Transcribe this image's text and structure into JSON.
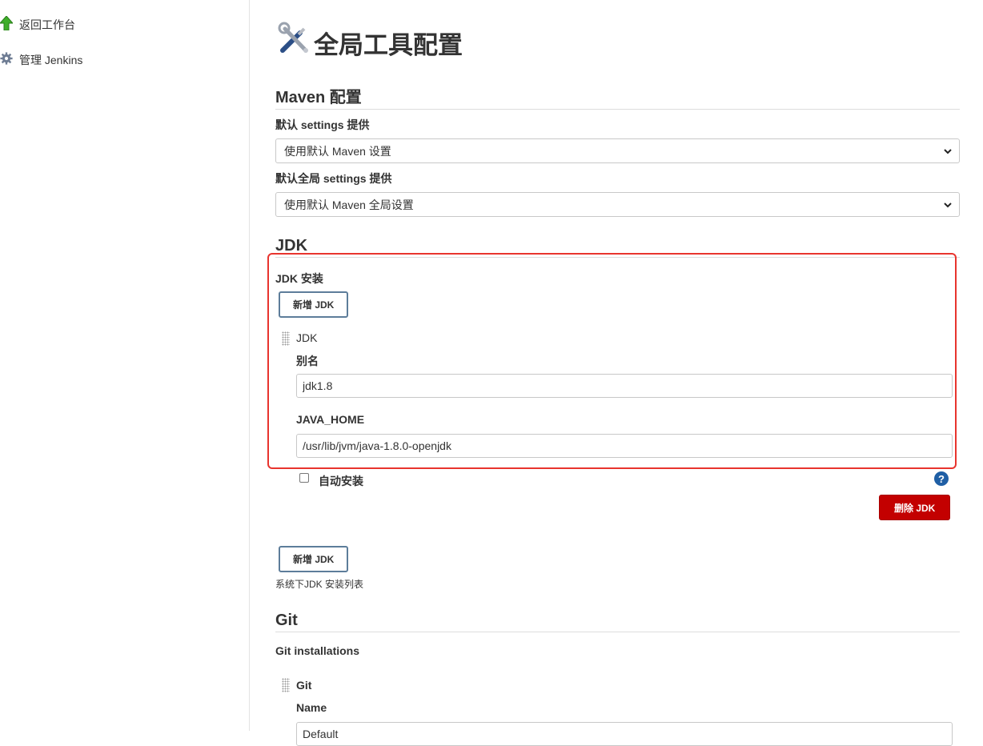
{
  "sidebar": {
    "items": [
      {
        "label": "返回工作台",
        "icon": "up-arrow-icon"
      },
      {
        "label": "管理 Jenkins",
        "icon": "gear-icon"
      }
    ]
  },
  "header": {
    "title": "全局工具配置",
    "icon": "tools-icon"
  },
  "maven": {
    "section_title": "Maven 配置",
    "settings_label": "默认 settings 提供",
    "settings_value": "使用默认 Maven 设置",
    "global_settings_label": "默认全局 settings 提供",
    "global_settings_value": "使用默认 Maven 全局设置"
  },
  "jdk": {
    "section_title": "JDK",
    "install_label": "JDK 安装",
    "add_button_top": "新增 JDK",
    "item_title": "JDK",
    "alias_label": "别名",
    "alias_value": "jdk1.8",
    "java_home_label": "JAVA_HOME",
    "java_home_value": "/usr/lib/jvm/java-1.8.0-openjdk",
    "auto_install_label": "自动安装",
    "auto_install_checked": false,
    "help_glyph": "?",
    "delete_button": "删除 JDK",
    "add_button_bottom": "新增 JDK",
    "list_desc": "系统下JDK 安装列表"
  },
  "git": {
    "section_title": "Git",
    "installations_label": "Git installations",
    "item_title": "Git",
    "name_label": "Name",
    "name_value": "Default"
  },
  "colors": {
    "highlight_border": "#e8342e",
    "delete_button": "#c30000",
    "help_icon": "#1f5fa5",
    "button_border": "#5d7d9a"
  }
}
